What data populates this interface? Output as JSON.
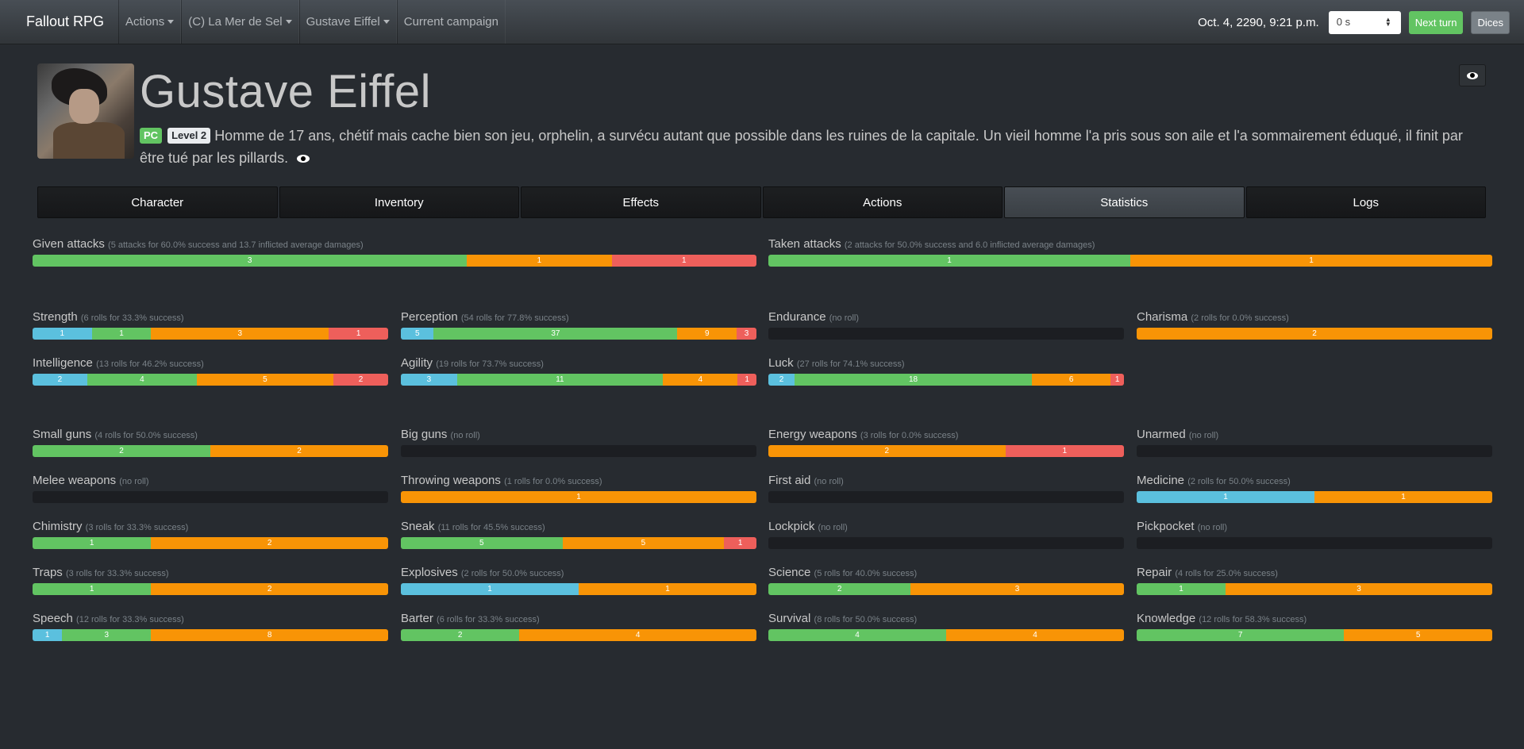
{
  "navbar": {
    "brand": "Fallout RPG",
    "items": [
      {
        "label": "Actions",
        "dropdown": true
      },
      {
        "label": "(C) La Mer de Sel",
        "dropdown": true
      },
      {
        "label": "Gustave Eiffel",
        "dropdown": true
      },
      {
        "label": "Current campaign",
        "dropdown": false
      }
    ],
    "date": "Oct. 4, 2290, 9:21 p.m.",
    "speed_value": "0 s",
    "next_turn_label": "Next turn",
    "dices_label": "Dices"
  },
  "header": {
    "name": "Gustave Eiffel",
    "badge_pc": "PC",
    "badge_level": "Level 2",
    "description": "Homme de 17 ans, chétif mais cache bien son jeu, orphelin, a survécu autant que possible dans les ruines de la capitale. Un vieil homme l'a pris sous son aile et l'a sommairement éduqué, il finit par être tué par les pillards."
  },
  "tabs": [
    "Character",
    "Inventory",
    "Effects",
    "Actions",
    "Statistics",
    "Logs"
  ],
  "active_tab": "Statistics",
  "colors": {
    "info": "#5bc0de",
    "success": "#62c462",
    "warning": "#f89406",
    "danger": "#ee5f5b"
  },
  "stats": {
    "attacks": [
      {
        "label": "Given attacks",
        "detail": "(5 attacks for 60.0% success and 13.7 inflicted average damages)",
        "segments": [
          {
            "type": "success",
            "value": 3
          },
          {
            "type": "warning",
            "value": 1
          },
          {
            "type": "danger",
            "value": 1
          }
        ]
      },
      {
        "label": "Taken attacks",
        "detail": "(2 attacks for 50.0% success and 6.0 inflicted average damages)",
        "segments": [
          {
            "type": "success",
            "value": 1
          },
          {
            "type": "warning",
            "value": 1
          }
        ]
      }
    ],
    "special": [
      {
        "label": "Strength",
        "detail": "(6 rolls for 33.3% success)",
        "segments": [
          {
            "type": "info",
            "value": 1
          },
          {
            "type": "success",
            "value": 1
          },
          {
            "type": "warning",
            "value": 3
          },
          {
            "type": "danger",
            "value": 1
          }
        ]
      },
      {
        "label": "Perception",
        "detail": "(54 rolls for 77.8% success)",
        "segments": [
          {
            "type": "info",
            "value": 5
          },
          {
            "type": "success",
            "value": 37
          },
          {
            "type": "warning",
            "value": 9
          },
          {
            "type": "danger",
            "value": 3
          }
        ]
      },
      {
        "label": "Endurance",
        "detail": "(no roll)",
        "segments": []
      },
      {
        "label": "Charisma",
        "detail": "(2 rolls for 0.0% success)",
        "segments": [
          {
            "type": "warning",
            "value": 2
          }
        ]
      },
      {
        "label": "Intelligence",
        "detail": "(13 rolls for 46.2% success)",
        "segments": [
          {
            "type": "info",
            "value": 2
          },
          {
            "type": "success",
            "value": 4
          },
          {
            "type": "warning",
            "value": 5
          },
          {
            "type": "danger",
            "value": 2
          }
        ]
      },
      {
        "label": "Agility",
        "detail": "(19 rolls for 73.7% success)",
        "segments": [
          {
            "type": "info",
            "value": 3
          },
          {
            "type": "success",
            "value": 11
          },
          {
            "type": "warning",
            "value": 4
          },
          {
            "type": "danger",
            "value": 1
          }
        ]
      },
      {
        "label": "Luck",
        "detail": "(27 rolls for 74.1% success)",
        "segments": [
          {
            "type": "info",
            "value": 2
          },
          {
            "type": "success",
            "value": 18
          },
          {
            "type": "warning",
            "value": 6
          },
          {
            "type": "danger",
            "value": 1
          }
        ]
      }
    ],
    "skills": [
      {
        "label": "Small guns",
        "detail": "(4 rolls for 50.0% success)",
        "segments": [
          {
            "type": "success",
            "value": 2
          },
          {
            "type": "warning",
            "value": 2
          }
        ]
      },
      {
        "label": "Big guns",
        "detail": "(no roll)",
        "segments": []
      },
      {
        "label": "Energy weapons",
        "detail": "(3 rolls for 0.0% success)",
        "segments": [
          {
            "type": "warning",
            "value": 2
          },
          {
            "type": "danger",
            "value": 1
          }
        ]
      },
      {
        "label": "Unarmed",
        "detail": "(no roll)",
        "segments": []
      },
      {
        "label": "Melee weapons",
        "detail": "(no roll)",
        "segments": []
      },
      {
        "label": "Throwing weapons",
        "detail": "(1 rolls for 0.0% success)",
        "segments": [
          {
            "type": "warning",
            "value": 1
          }
        ]
      },
      {
        "label": "First aid",
        "detail": "(no roll)",
        "segments": []
      },
      {
        "label": "Medicine",
        "detail": "(2 rolls for 50.0% success)",
        "segments": [
          {
            "type": "info",
            "value": 1
          },
          {
            "type": "warning",
            "value": 1
          }
        ]
      },
      {
        "label": "Chimistry",
        "detail": "(3 rolls for 33.3% success)",
        "segments": [
          {
            "type": "success",
            "value": 1
          },
          {
            "type": "warning",
            "value": 2
          }
        ]
      },
      {
        "label": "Sneak",
        "detail": "(11 rolls for 45.5% success)",
        "segments": [
          {
            "type": "success",
            "value": 5
          },
          {
            "type": "warning",
            "value": 5
          },
          {
            "type": "danger",
            "value": 1
          }
        ]
      },
      {
        "label": "Lockpick",
        "detail": "(no roll)",
        "segments": []
      },
      {
        "label": "Pickpocket",
        "detail": "(no roll)",
        "segments": []
      },
      {
        "label": "Traps",
        "detail": "(3 rolls for 33.3% success)",
        "segments": [
          {
            "type": "success",
            "value": 1
          },
          {
            "type": "warning",
            "value": 2
          }
        ]
      },
      {
        "label": "Explosives",
        "detail": "(2 rolls for 50.0% success)",
        "segments": [
          {
            "type": "info",
            "value": 1
          },
          {
            "type": "warning",
            "value": 1
          }
        ]
      },
      {
        "label": "Science",
        "detail": "(5 rolls for 40.0% success)",
        "segments": [
          {
            "type": "success",
            "value": 2
          },
          {
            "type": "warning",
            "value": 3
          }
        ]
      },
      {
        "label": "Repair",
        "detail": "(4 rolls for 25.0% success)",
        "segments": [
          {
            "type": "success",
            "value": 1
          },
          {
            "type": "warning",
            "value": 3
          }
        ]
      },
      {
        "label": "Speech",
        "detail": "(12 rolls for 33.3% success)",
        "segments": [
          {
            "type": "info",
            "value": 1
          },
          {
            "type": "success",
            "value": 3
          },
          {
            "type": "warning",
            "value": 8
          }
        ]
      },
      {
        "label": "Barter",
        "detail": "(6 rolls for 33.3% success)",
        "segments": [
          {
            "type": "success",
            "value": 2
          },
          {
            "type": "warning",
            "value": 4
          }
        ]
      },
      {
        "label": "Survival",
        "detail": "(8 rolls for 50.0% success)",
        "segments": [
          {
            "type": "success",
            "value": 4
          },
          {
            "type": "warning",
            "value": 4
          }
        ]
      },
      {
        "label": "Knowledge",
        "detail": "(12 rolls for 58.3% success)",
        "segments": [
          {
            "type": "success",
            "value": 7
          },
          {
            "type": "warning",
            "value": 5
          }
        ]
      }
    ]
  }
}
